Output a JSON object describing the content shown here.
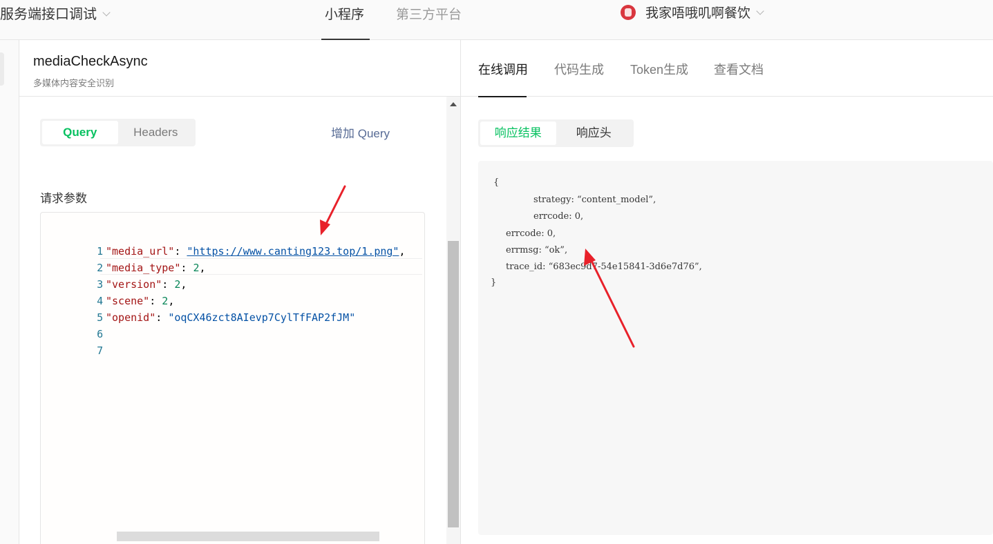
{
  "topbar": {
    "app_title": "服务端接口调试",
    "tabs": [
      {
        "label": "小程序",
        "active": true
      },
      {
        "label": "第三方平台",
        "active": false
      }
    ],
    "account_name": "我家唔哦叽啊餐饮"
  },
  "left": {
    "api_name": "mediaCheckAsync",
    "api_desc": "多媒体内容安全识别",
    "seg": [
      {
        "label": "Query",
        "active": true
      },
      {
        "label": "Headers",
        "active": false
      }
    ],
    "add_query": "增加 Query",
    "params_label": "请求参数",
    "editor": {
      "line_numbers": [
        "1",
        "2",
        "3",
        "4",
        "5",
        "6",
        "7"
      ],
      "lines": [
        {
          "key": "\"media_url\"",
          "value": "\"https://www.canting123.top/1.png\""
        },
        {
          "key": "\"media_type\"",
          "value": "2"
        },
        {
          "key": "\"version\"",
          "value": "2"
        },
        {
          "key": "\"scene\"",
          "value": "2"
        },
        {
          "key": "\"openid\"",
          "value": "\"oqCX46zct8AIevp7CylTfFAP2fJM\""
        }
      ]
    }
  },
  "right": {
    "tabs": [
      {
        "label": "在线调用",
        "active": true
      },
      {
        "label": "代码生成",
        "active": false
      },
      {
        "label": "Token生成",
        "active": false
      },
      {
        "label": "查看文档",
        "active": false
      }
    ],
    "seg": [
      {
        "label": "响应结果",
        "active": true
      },
      {
        "label": "响应头",
        "active": false
      }
    ],
    "result_lines": [
      "{",
      "strategy: “content_model”,",
      "errcode: 0,",
      "errcode: 0,",
      "errmsg: “ok”,",
      "trace_id: “683ec9d7-54e15841-3d6e7d76”,",
      "}"
    ]
  },
  "colors": {
    "accent_green": "#07c160",
    "link_blue": "#576b95",
    "annotation_red": "#e8212a"
  }
}
